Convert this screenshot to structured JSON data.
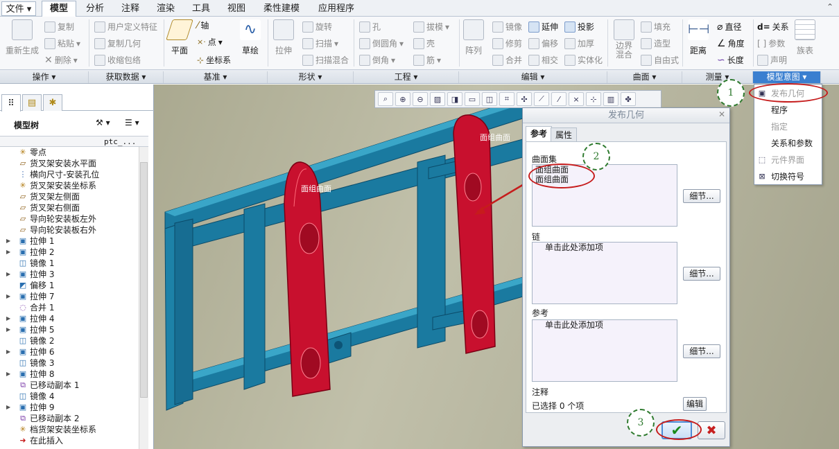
{
  "menubar": {
    "items": [
      "文件",
      "模型",
      "分析",
      "注释",
      "渲染",
      "工具",
      "视图",
      "柔性建模",
      "应用程序"
    ],
    "active": "模型"
  },
  "ribbon": {
    "operations": {
      "regen": "重新生成",
      "copy": "复制",
      "paste": "粘贴",
      "delete": "删除"
    },
    "get_data": {
      "udf": "用户定义特征",
      "copy_geom": "复制几何",
      "shrinkwrap": "收缩包络"
    },
    "datum": {
      "plane": "平面",
      "axis": "轴",
      "point": "点",
      "csys": "坐标系",
      "sketch": "草绘"
    },
    "shapes": {
      "extrude": "拉伸",
      "revolve": "旋转",
      "sweep": "扫描",
      "swept_blend": "扫描混合"
    },
    "engineering": {
      "hole": "孔",
      "round": "倒圆角",
      "chamfer": "倒角",
      "draft": "拔模",
      "shell": "壳",
      "rib": "筋"
    },
    "editing": {
      "pattern": "阵列",
      "mirror": "镜像",
      "trim": "修剪",
      "merge": "合并",
      "extend": "延伸",
      "offset": "偏移",
      "intersect": "相交",
      "project": "投影",
      "thicken": "加厚",
      "solidify": "实体化"
    },
    "surfaces": {
      "boundary": "边界混合",
      "fill": "填充",
      "style": "造型",
      "freestyle": "自由式"
    },
    "measure": {
      "distance": "距离",
      "diameter": "直径",
      "angle": "角度",
      "length": "长度"
    },
    "model_intent": {
      "relations": "关系",
      "parameters": "参数",
      "declare": "声明",
      "family_table": "族表"
    }
  },
  "groups": [
    "操作",
    "获取数据",
    "基准",
    "形状",
    "工程",
    "编辑",
    "曲面",
    "测量",
    "模型意图"
  ],
  "model_tree": {
    "title": "模型树",
    "column": "ptc_...",
    "items": [
      {
        "label": "零点",
        "icon": "csys",
        "expand": false
      },
      {
        "label": "货叉架安装水平面",
        "icon": "plane",
        "expand": false
      },
      {
        "label": "横向尺寸-安装孔位",
        "icon": "axis",
        "expand": false
      },
      {
        "label": "货叉架安装坐标系",
        "icon": "csys",
        "expand": false
      },
      {
        "label": "货叉架左侧面",
        "icon": "plane",
        "expand": false
      },
      {
        "label": "货叉架右侧面",
        "icon": "plane",
        "expand": false
      },
      {
        "label": "导向轮安装板左外",
        "icon": "plane",
        "expand": false
      },
      {
        "label": "导向轮安装板右外",
        "icon": "plane",
        "expand": false
      },
      {
        "label": "拉伸 1",
        "icon": "extrude",
        "expand": true
      },
      {
        "label": "拉伸 2",
        "icon": "extrude",
        "expand": true
      },
      {
        "label": "镜像 1",
        "icon": "mirror",
        "expand": false
      },
      {
        "label": "拉伸 3",
        "icon": "extrude",
        "expand": true
      },
      {
        "label": "偏移 1",
        "icon": "offset",
        "expand": false
      },
      {
        "label": "拉伸 7",
        "icon": "extrude",
        "expand": true
      },
      {
        "label": "合并 1",
        "icon": "merge",
        "expand": false
      },
      {
        "label": "拉伸 4",
        "icon": "extrude",
        "expand": true
      },
      {
        "label": "拉伸 5",
        "icon": "extrude",
        "expand": true
      },
      {
        "label": "镜像 2",
        "icon": "mirror",
        "expand": false
      },
      {
        "label": "拉伸 6",
        "icon": "extrude",
        "expand": true
      },
      {
        "label": "镜像 3",
        "icon": "mirror",
        "expand": false
      },
      {
        "label": "拉伸 8",
        "icon": "extrude",
        "expand": true
      },
      {
        "label": "已移动副本 1",
        "icon": "copy",
        "expand": false
      },
      {
        "label": "镜像 4",
        "icon": "mirror",
        "expand": false
      },
      {
        "label": "拉伸 9",
        "icon": "extrude",
        "expand": true
      },
      {
        "label": "已移动副本 2",
        "icon": "copy",
        "expand": false
      },
      {
        "label": "档货架安装坐标系",
        "icon": "csys",
        "expand": false
      },
      {
        "label": "在此插入",
        "icon": "insert",
        "expand": false
      }
    ]
  },
  "viewport": {
    "surface_label_left": "面组曲面",
    "surface_label_right": "面组曲面"
  },
  "dialog": {
    "title": "发布几何",
    "tabs": [
      "参考",
      "属性"
    ],
    "surface_set_label": "曲面集",
    "surface_set_items": [
      "面组曲面",
      "面组曲面"
    ],
    "chain_label": "链",
    "chain_placeholder": "单击此处添加项",
    "ref_label": "参考",
    "ref_placeholder": "单击此处添加项",
    "details_btn": "细节...",
    "note_label": "注释",
    "selected_text": "已选择 0 个项",
    "edit_btn": "编辑"
  },
  "dropdown": {
    "header": "模型意图",
    "items": [
      {
        "label": "发布几何",
        "disabled": true
      },
      {
        "label": "程序",
        "disabled": false
      },
      {
        "label": "指定",
        "disabled": false
      },
      {
        "label": "关系和参数",
        "disabled": false
      },
      {
        "label": "元件界面",
        "disabled": true
      },
      {
        "label": "切换符号",
        "disabled": false
      }
    ]
  },
  "callouts": [
    "1",
    "2",
    "3"
  ],
  "colors": {
    "highlight_red": "#c8102e",
    "frame_blue": "#1a7aa0",
    "accent": "#3a7fd0"
  }
}
